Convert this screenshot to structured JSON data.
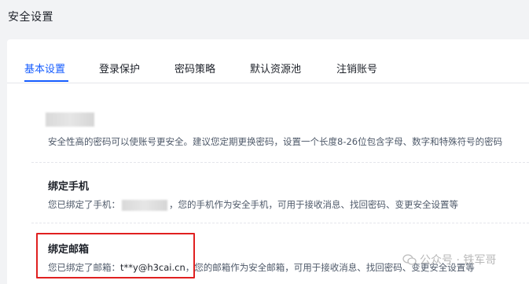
{
  "header": {
    "title": "安全设置"
  },
  "tabs": [
    {
      "label": "基本设置",
      "active": true
    },
    {
      "label": "登录保护",
      "active": false
    },
    {
      "label": "密码策略",
      "active": false
    },
    {
      "label": "默认资源池",
      "active": false
    },
    {
      "label": "注销账号",
      "active": false
    }
  ],
  "password": {
    "desc": "安全性高的密码可以使账号更安全。建议您定期更换密码，设置一个长度8-26位包含字母、数字和特殊符号的密码"
  },
  "phone": {
    "title": "绑定手机",
    "desc_prefix": "您已绑定了手机：",
    "desc_suffix": "，您的手机作为安全手机，可用于接收消息、找回密码、变更安全设置等"
  },
  "email": {
    "title": "绑定邮箱",
    "desc_prefix": "您已绑定了邮箱：",
    "value": "t**y@h3cai.cn",
    "desc_suffix": "，您的邮箱作为安全邮箱，可用于接收消息、找回密码、变更安全设置等"
  },
  "watermark": {
    "text": "公众号 · 铁军哥"
  },
  "colors": {
    "accent": "#165dff",
    "highlight": "#e02020",
    "background": "#f2f3f5"
  }
}
